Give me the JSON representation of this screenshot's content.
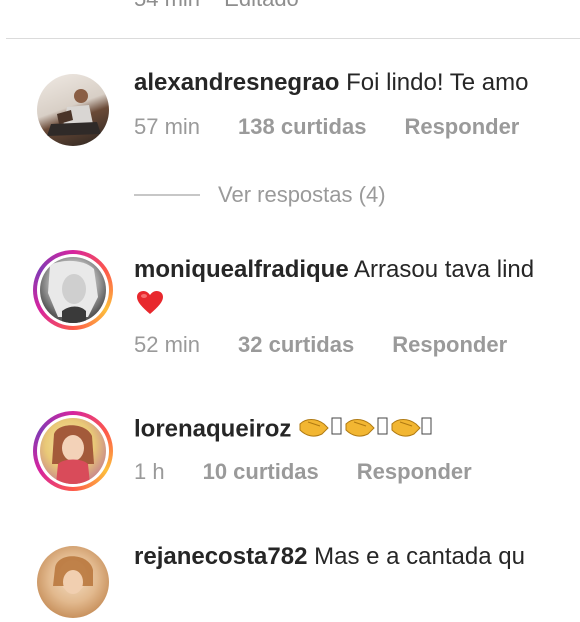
{
  "top_comment": {
    "time": "54 min",
    "status": "Editado"
  },
  "comments": [
    {
      "username": "alexandresnegrao",
      "text": "Foi lindo! Te amo",
      "time": "57 min",
      "likes": "138 curtidas",
      "reply": "Responder",
      "view_replies": "Ver respostas (4)"
    },
    {
      "username": "moniquealfradique",
      "text": "Arrasou tava lind",
      "emoji": "red-heart",
      "time": "52 min",
      "likes": "32 curtidas",
      "reply": "Responder"
    },
    {
      "username": "lorenaqueiroz",
      "emoji": "clapping-hands-with-missing-glyphs",
      "time": "1 h",
      "likes": "10 curtidas",
      "reply": "Responder"
    },
    {
      "username": "rejanecosta782",
      "text": "Mas e  a cantada qu"
    }
  ],
  "colors": {
    "meta_gray": "#9a9a9a",
    "divider": "#dbdbdb",
    "heart": "#e8282d"
  }
}
